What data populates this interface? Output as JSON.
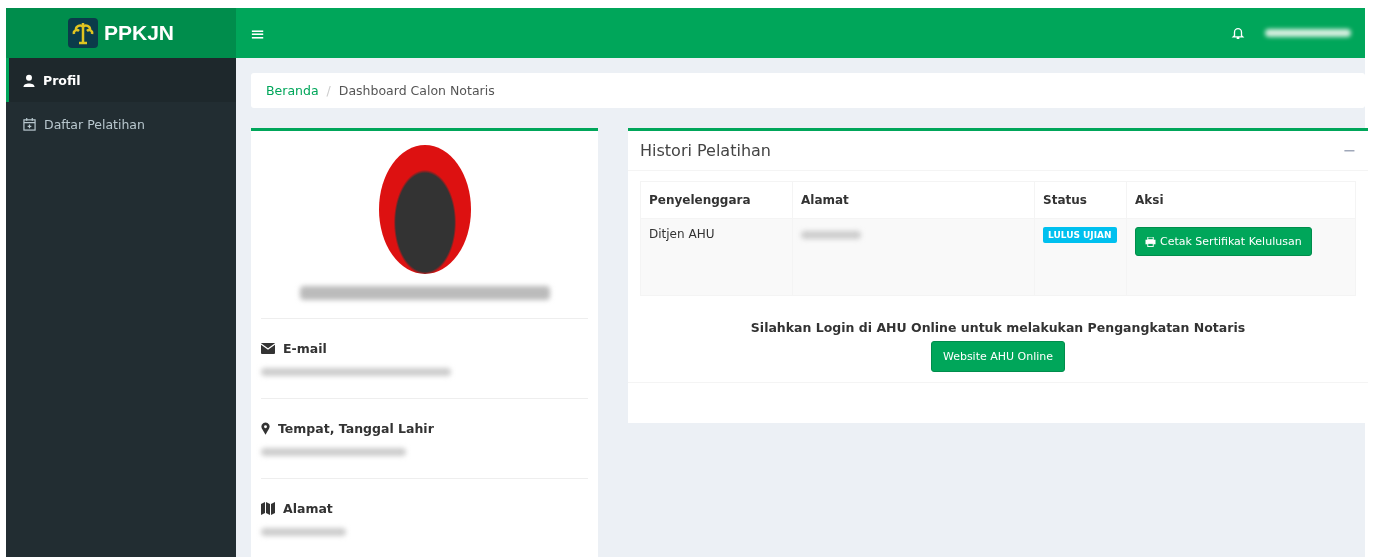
{
  "brand": {
    "title": "PPKJN"
  },
  "topbar": {
    "menu_icon": "≡"
  },
  "sidebar": {
    "items": [
      {
        "label": "Profil",
        "selected": true,
        "kind": "user"
      },
      {
        "label": "Daftar Pelatihan",
        "selected": false,
        "kind": "calendar"
      }
    ]
  },
  "breadcrumb_separator": "/",
  "breadcrumb": [
    {
      "label": "Beranda",
      "kind": "link"
    },
    {
      "label": "Dashboard Calon Notaris",
      "kind": "current"
    }
  ],
  "profile": {
    "fields": [
      {
        "label": "E-mail",
        "kind": "email"
      },
      {
        "label": "Tempat, Tanggal Lahir",
        "kind": "place"
      },
      {
        "label": "Alamat",
        "kind": "map"
      }
    ]
  },
  "history": {
    "title": "Histori Pelatihan",
    "collapse_icon": "−",
    "columns": [
      "Penyelenggara",
      "Alamat",
      "Status",
      "Aksi"
    ],
    "rows": [
      {
        "organizer": "Ditjen AHU",
        "status": "LULUS UJIAN",
        "action": "Cetak Sertifikat Kelulusan"
      }
    ],
    "notice": "Silahkan Login di AHU Online untuk melakukan Pengangkatan Notaris",
    "notice_button": "Website AHU Online"
  }
}
